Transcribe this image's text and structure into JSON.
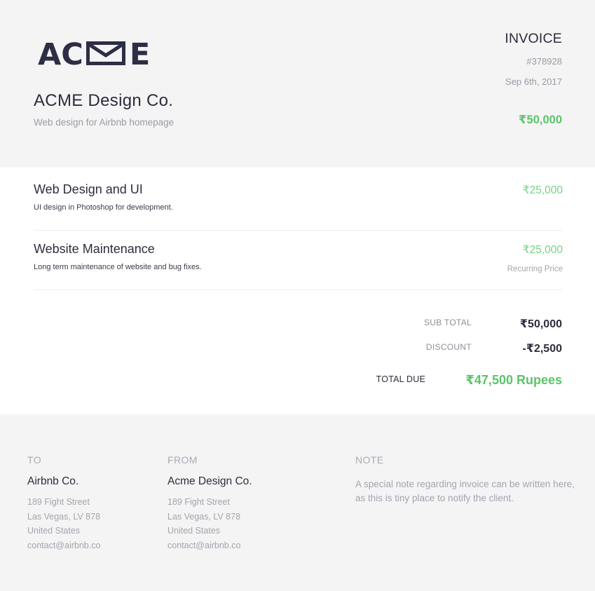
{
  "colors": {
    "accent_green": "#5cc46a",
    "header_bg": "#f4f4f5",
    "dark_text": "#2d2d3d",
    "muted_text": "#9a9aa3"
  },
  "logo": {
    "left": "AC",
    "right": "E",
    "icon": "envelope-icon"
  },
  "company": {
    "name": "ACME Design Co.",
    "tagline": "Web design for Airbnb homepage"
  },
  "invoice": {
    "title": "INVOICE",
    "number": "#378928",
    "date": "Sep 6th, 2017",
    "amount": "₹50,000"
  },
  "items": [
    {
      "title": "Web Design and UI",
      "description": "UI design in Photoshop for development.",
      "price": "₹25,000",
      "note": ""
    },
    {
      "title": "Website Maintenance",
      "description": "Long term maintenance of website and bug fixes.",
      "price": "₹25,000",
      "note": "Recurring Price"
    }
  ],
  "summary": {
    "subtotal_label": "SUB TOTAL",
    "subtotal_value": "₹50,000",
    "discount_label": "DISCOUNT",
    "discount_value": "-₹2,500",
    "total_label": "TOTAL DUE",
    "total_value": "₹47,500 Rupees"
  },
  "to": {
    "label": "TO",
    "name": "Airbnb Co.",
    "lines": [
      "189 Fight Street",
      "Las Vegas, LV 878",
      "United States",
      "contact@airbnb.co"
    ]
  },
  "from": {
    "label": "FROM",
    "name": "Acme Design Co.",
    "lines": [
      "189 Fight Street",
      "Las Vegas, LV 878",
      "United States",
      "contact@airbnb.co"
    ]
  },
  "note": {
    "label": "NOTE",
    "text": "A special note regarding invoice can be written here, as this is tiny place to notify the client."
  }
}
